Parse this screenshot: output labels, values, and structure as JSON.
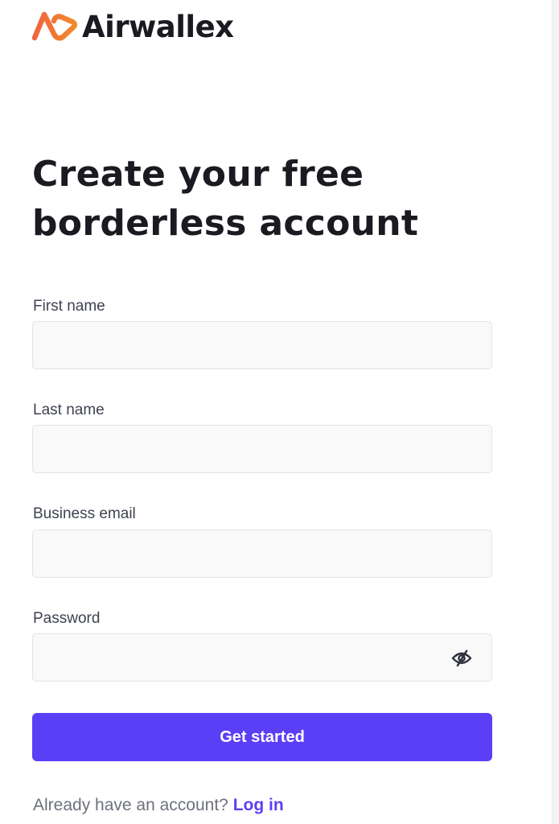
{
  "brand": {
    "name": "Airwallex",
    "accent_color": "#f06a3a",
    "logo_icon": "airwallex-logo-icon"
  },
  "heading": {
    "line1": "Create your free",
    "line2": "borderless account"
  },
  "form": {
    "first_name": {
      "label": "First name",
      "value": "",
      "placeholder": ""
    },
    "last_name": {
      "label": "Last name",
      "value": "",
      "placeholder": ""
    },
    "email": {
      "label": "Business email",
      "value": "",
      "placeholder": ""
    },
    "password": {
      "label": "Password",
      "value": "",
      "placeholder": "",
      "toggle_icon": "eye-off-icon"
    },
    "submit_label": "Get started"
  },
  "footer": {
    "prompt": "Already have an account?",
    "login_label": "Log in"
  },
  "colors": {
    "primary": "#5b3ff7",
    "text": "#1a1b21",
    "muted": "#6d717d",
    "input_bg": "#f9f9fa",
    "input_border": "#e3e4e8"
  }
}
